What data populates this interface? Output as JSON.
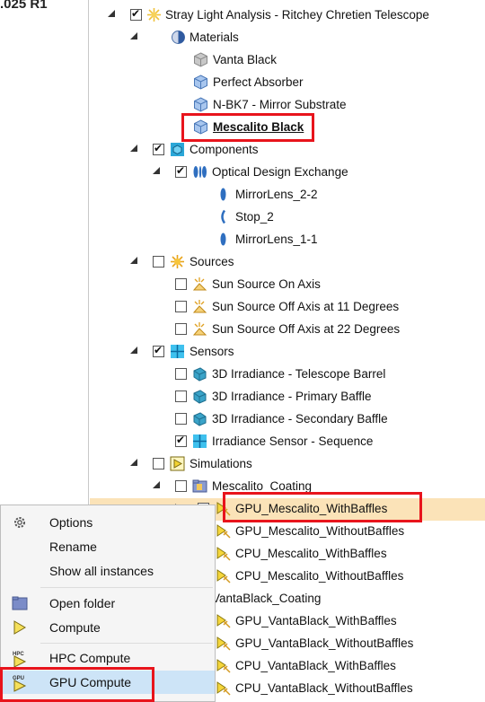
{
  "left_fragment": ".025 R1",
  "tree": [
    {
      "label": "Stray Light Analysis - Ritchey Chretien Telescope",
      "icon": "sun-analysis-icon",
      "checked": true,
      "expander": "open"
    },
    {
      "label": "Materials",
      "icon": "materials-sphere-icon",
      "expander": "open"
    },
    {
      "label": "Vanta Black",
      "icon": "material-cube-gray-icon"
    },
    {
      "label": "Perfect Absorber",
      "icon": "material-cube-blue-icon"
    },
    {
      "label": "N-BK7 - Mirror Substrate",
      "icon": "material-cube-blue-icon"
    },
    {
      "label": "Mescalito Black",
      "icon": "material-cube-blue-icon"
    },
    {
      "label": "Components",
      "icon": "components-icon",
      "checked": true,
      "expander": "open"
    },
    {
      "label": "Optical Design Exchange",
      "icon": "optical-lens-icon",
      "checked": true,
      "expander": "open"
    },
    {
      "label": "MirrorLens_2-2",
      "icon": "lens-blue-icon"
    },
    {
      "label": "Stop_2",
      "icon": "stop-icon"
    },
    {
      "label": "MirrorLens_1-1",
      "icon": "lens-blue-icon"
    },
    {
      "label": "Sources",
      "icon": "sources-sun-icon",
      "checked": false,
      "expander": "open"
    },
    {
      "label": "Sun Source On Axis",
      "icon": "sun-source-icon",
      "checked": false
    },
    {
      "label": "Sun Source Off Axis at 11 Degrees",
      "icon": "sun-source-icon",
      "checked": false
    },
    {
      "label": "Sun Source Off Axis at 22 Degrees",
      "icon": "sun-source-icon",
      "checked": false
    },
    {
      "label": "Sensors",
      "icon": "sensors-icon",
      "checked": true,
      "expander": "open"
    },
    {
      "label": "3D Irradiance - Telescope Barrel",
      "icon": "irradiance-3d-icon",
      "checked": false
    },
    {
      "label": "3D Irradiance - Primary Baffle",
      "icon": "irradiance-3d-icon",
      "checked": false
    },
    {
      "label": "3D Irradiance - Secondary Baffle",
      "icon": "irradiance-3d-icon",
      "checked": false
    },
    {
      "label": "Irradiance Sensor - Sequence",
      "icon": "irradiance-sensor-icon",
      "checked": true
    },
    {
      "label": "Simulations",
      "icon": "simulations-play-icon",
      "checked": false,
      "expander": "open"
    },
    {
      "label": "Mescalito_Coating",
      "icon": "folder-icon",
      "checked": false,
      "expander": "open"
    },
    {
      "label": "GPU_Mescalito_WithBaffles",
      "icon": "simulation-icon",
      "checked": false,
      "expander": "closed"
    },
    {
      "label": "GPU_Mescalito_WithoutBaffles",
      "icon": "simulation-icon"
    },
    {
      "label": "CPU_Mescalito_WithBaffles",
      "icon": "simulation-icon"
    },
    {
      "label": "CPU_Mescalito_WithoutBaffles",
      "icon": "simulation-icon"
    },
    {
      "label": "VantaBlack_Coating",
      "icon": "folder-icon"
    },
    {
      "label": "GPU_VantaBlack_WithBaffles",
      "icon": "simulation-icon"
    },
    {
      "label": "GPU_VantaBlack_WithoutBaffles",
      "icon": "simulation-icon"
    },
    {
      "label": "CPU_VantaBlack_WithBaffles",
      "icon": "simulation-icon"
    },
    {
      "label": "CPU_VantaBlack_WithoutBaffles",
      "icon": "simulation-icon"
    }
  ],
  "menu": [
    {
      "label": "Options",
      "icon": "gear-icon"
    },
    {
      "label": "Rename"
    },
    {
      "label": "Show all instances"
    },
    {
      "label": "Open folder",
      "icon": "folder-open-icon"
    },
    {
      "label": "Compute",
      "icon": "compute-play-icon"
    },
    {
      "label": "HPC Compute",
      "icon": "hpc-compute-icon"
    },
    {
      "label": "GPU Compute",
      "icon": "gpu-compute-icon"
    }
  ],
  "colors": {
    "highlight": "#e8141c",
    "selected_row": "#fbe3b8",
    "menu_selected": "#cde4f7"
  }
}
